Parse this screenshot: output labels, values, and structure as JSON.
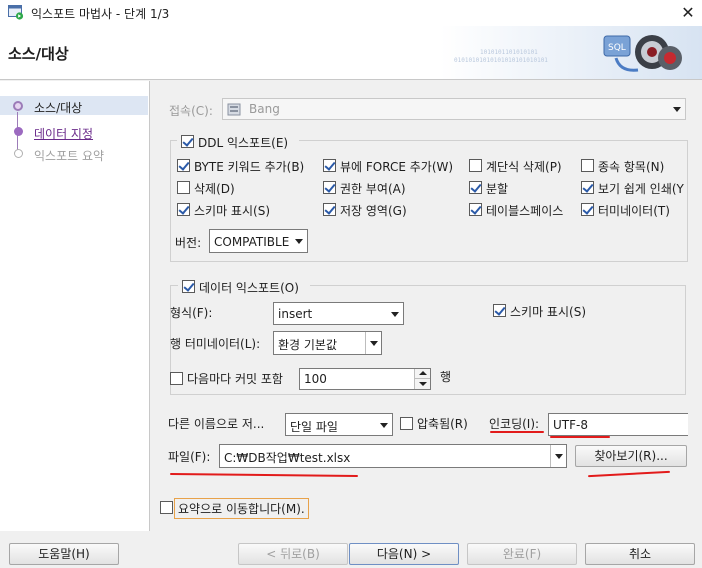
{
  "window": {
    "title": "익스포트 마법사 - 단계 1/3",
    "close_glyph": "✕"
  },
  "header": {
    "title": "소스/대상"
  },
  "steps": [
    {
      "label": "소스/대상",
      "state": "current"
    },
    {
      "label": "데이터 지정",
      "state": "link"
    },
    {
      "label": "익스포트 요약",
      "state": "disabled"
    }
  ],
  "connection": {
    "label": "접속(C):",
    "value": "Bang"
  },
  "ddl": {
    "label": "DDL 익스포트(E)",
    "checked": true,
    "options": [
      {
        "label": "BYTE 키워드 추가(B)",
        "checked": true
      },
      {
        "label": "뷰에 FORCE 추가(W)",
        "checked": true
      },
      {
        "label": "계단식 삭제(P)",
        "checked": false
      },
      {
        "label": "종속 항목(N)",
        "checked": false
      },
      {
        "label": "삭제(D)",
        "checked": false
      },
      {
        "label": "권한 부여(A)",
        "checked": true
      },
      {
        "label": "분할",
        "checked": true
      },
      {
        "label": "보기 쉽게 인쇄(Y",
        "checked": true
      },
      {
        "label": "스키마 표시(S)",
        "checked": true
      },
      {
        "label": "저장 영역(G)",
        "checked": true
      },
      {
        "label": "테이블스페이스",
        "checked": true
      },
      {
        "label": "터미네이터(T)",
        "checked": true
      }
    ],
    "version_label": "버전:",
    "version_value": "COMPATIBLE"
  },
  "data_export": {
    "label": "데이터 익스포트(O)",
    "checked": true,
    "format_label": "형식(F):",
    "format_value": "insert",
    "schema_label": "스키마 표시(S)",
    "schema_checked": true,
    "terminator_label": "행 터미네이터(L):",
    "terminator_value": "환경 기본값",
    "commit_label": "다음마다 커밋 포함",
    "commit_checked": false,
    "commit_value": "100",
    "commit_unit": "행"
  },
  "save": {
    "save_as_label": "다른 이름으로 저...",
    "save_as_value": "단일 파일",
    "compressed_label": "압축됨(R)",
    "compressed_checked": false,
    "encoding_label": "인코딩(I):",
    "encoding_value": "UTF-8",
    "file_label": "파일(F):",
    "file_value": "C:₩DB작업₩test.xlsx",
    "browse_label": "찾아보기(R)..."
  },
  "summary_jump": {
    "label": "요약으로 이동합니다(M).",
    "checked": false
  },
  "buttons": {
    "help": "도움말(H)",
    "back": "< 뒤로(B)",
    "next": "다음(N) >",
    "finish": "완료(F)",
    "cancel": "취소"
  },
  "colors": {
    "annotation_red": "#e21b1b",
    "step_link": "#6a2a8a",
    "focus_orange": "#e8a24a",
    "check_blue": "#2b5aa8"
  }
}
